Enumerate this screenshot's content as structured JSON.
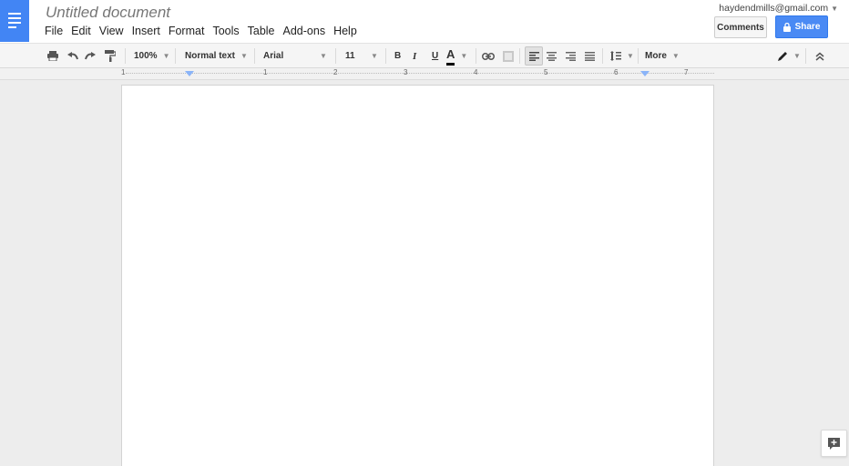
{
  "app": {
    "doc_title": "Untitled document",
    "account_email": "haydendmills@gmail.com",
    "brand_color": "#4285f4"
  },
  "menu": [
    "File",
    "Edit",
    "View",
    "Insert",
    "Format",
    "Tools",
    "Table",
    "Add-ons",
    "Help"
  ],
  "buttons": {
    "comments": "Comments",
    "share": "Share"
  },
  "toolbar": {
    "zoom": "100%",
    "style": "Normal text",
    "font": "Arial",
    "font_size": "11",
    "bold": "B",
    "italic": "I",
    "underline": "U",
    "text_color": "A",
    "more": "More"
  },
  "ruler": {
    "labels": [
      "1",
      "1",
      "2",
      "3",
      "4",
      "5",
      "6",
      "7"
    ]
  },
  "icons": [
    "docs-logo-icon",
    "print-icon",
    "undo-icon",
    "redo-icon",
    "paint-format-icon",
    "link-icon",
    "comment-icon",
    "align-left-icon",
    "align-center-icon",
    "align-right-icon",
    "justify-icon",
    "line-spacing-icon",
    "pencil-icon",
    "collapse-icon",
    "add-comment-icon"
  ]
}
